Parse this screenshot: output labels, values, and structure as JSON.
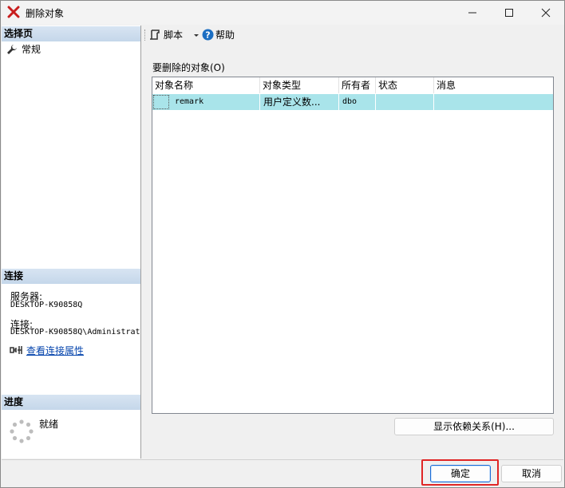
{
  "window": {
    "title": "删除对象",
    "controls": [
      "minimize",
      "maximize",
      "close"
    ]
  },
  "left": {
    "select_page": {
      "header": "选择页",
      "items": [
        {
          "label": "常规",
          "icon": "wrench-icon"
        }
      ]
    },
    "connection": {
      "header": "连接",
      "server_label": "服务器:",
      "server_value": "DESKTOP-K90858Q",
      "connection_label": "连接:",
      "connection_value": "DESKTOP-K90858Q\\Administrat",
      "view_props_link": "查看连接属性"
    },
    "progress": {
      "header": "进度",
      "status": "就绪"
    }
  },
  "toolbar": {
    "script_label": "脚本",
    "help_label": "帮助"
  },
  "objects": {
    "group_label": "要删除的对象(O)",
    "columns": [
      "对象名称",
      "对象类型",
      "所有者",
      "状态",
      "消息"
    ],
    "rows": [
      {
        "name": "remark",
        "type": "用户定义数...",
        "owner": "dbo",
        "status": "",
        "message": ""
      }
    ]
  },
  "buttons": {
    "show_dependencies": "显示依赖关系(H)...",
    "ok": "确定",
    "cancel": "取消"
  },
  "colors": {
    "selected_row": "#a9e4ea",
    "section_header": "#c5d7ea",
    "highlight_box": "#e02525",
    "link": "#0645ad"
  }
}
